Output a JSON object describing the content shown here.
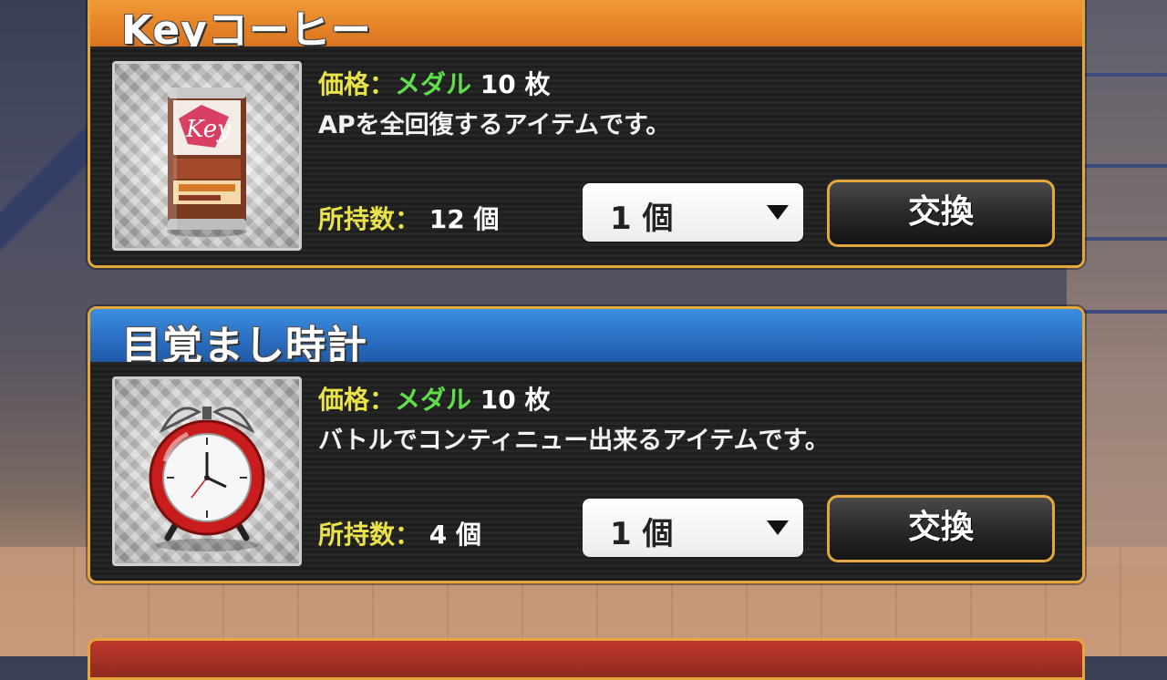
{
  "items": [
    {
      "name": "Keyコーヒー",
      "price_label": "価格",
      "price_sep": "：",
      "currency": "メダル",
      "price_value": "10 枚",
      "description": "APを全回復するアイテムです。",
      "owned_label": "所持数",
      "owned_sep": "：",
      "owned_value": "12 個",
      "quantity": "1 個",
      "exchange_label": "交換",
      "icon": "coffee-can-icon",
      "theme": "orange"
    },
    {
      "name": "目覚まし時計",
      "price_label": "価格",
      "price_sep": "：",
      "currency": "メダル",
      "price_value": "10 枚",
      "description": "バトルでコンティニュー出来るアイテムです。",
      "owned_label": "所持数",
      "owned_sep": "：",
      "owned_value": "4 個",
      "quantity": "1 個",
      "exchange_label": "交換",
      "icon": "alarm-clock-icon",
      "theme": "blue"
    }
  ],
  "colors": {
    "orange_header": "#e7862a",
    "blue_header": "#2b70c4",
    "gold_border": "#e3a73b",
    "label_yellow": "#e9e24a",
    "label_green": "#5fe04a"
  }
}
